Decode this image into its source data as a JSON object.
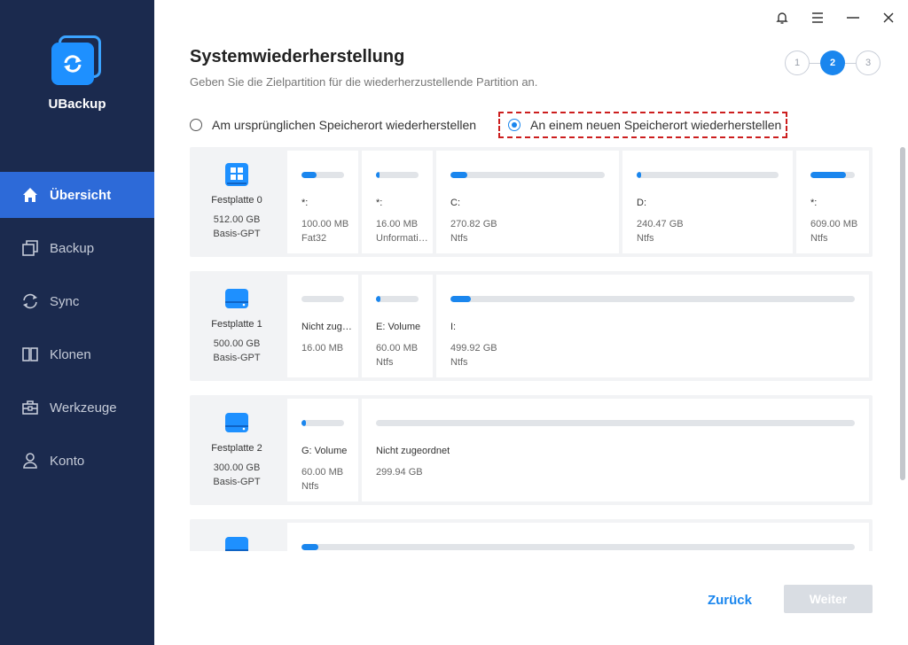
{
  "app": {
    "name": "UBackup"
  },
  "sidebar": {
    "items": [
      {
        "label": "Übersicht",
        "icon": "home-icon",
        "active": true
      },
      {
        "label": "Backup",
        "icon": "backup-icon"
      },
      {
        "label": "Sync",
        "icon": "sync-icon"
      },
      {
        "label": "Klonen",
        "icon": "clone-icon"
      },
      {
        "label": "Werkzeuge",
        "icon": "toolbox-icon"
      },
      {
        "label": "Konto",
        "icon": "user-icon"
      }
    ]
  },
  "header": {
    "title": "Systemwiederherstellung",
    "subtitle": "Geben Sie die Zielpartition für die wiederherzustellende Partition an."
  },
  "steps": [
    "1",
    "2",
    "3"
  ],
  "current_step": 2,
  "restore_options": {
    "original": "Am ursprünglichen Speicherort wiederherstellen",
    "new": "An einem neuen Speicherort wiederherstellen",
    "selected": "new"
  },
  "disks": [
    {
      "name": "Festplatte 0",
      "size": "512.00 GB",
      "type": "Basis-GPT",
      "partitions": [
        {
          "label": "*:",
          "size": "100.00 MB",
          "fs": "Fat32",
          "fill": 0.35
        },
        {
          "label": "*:",
          "size": "16.00 MB",
          "fs": "Unformatiert",
          "fill": 0.08
        },
        {
          "label": "C:",
          "size": "270.82 GB",
          "fs": "Ntfs",
          "fill": 0.11
        },
        {
          "label": "D:",
          "size": "240.47 GB",
          "fs": "Ntfs",
          "fill": 0.03
        },
        {
          "label": "*:",
          "size": "609.00 MB",
          "fs": "Ntfs",
          "fill": 0.8
        }
      ]
    },
    {
      "name": "Festplatte 1",
      "size": "500.00 GB",
      "type": "Basis-GPT",
      "partitions": [
        {
          "label": "Nicht zugeordnet",
          "size": "16.00 MB",
          "fs": "",
          "fill": 0
        },
        {
          "label": "E: Volume",
          "size": "60.00 MB",
          "fs": "Ntfs",
          "fill": 0.1
        },
        {
          "label": "I:",
          "size": "499.92 GB",
          "fs": "Ntfs",
          "fill": 0.05
        }
      ]
    },
    {
      "name": "Festplatte 2",
      "size": "300.00 GB",
      "type": "Basis-GPT",
      "partitions": [
        {
          "label": "G: Volume",
          "size": "60.00 MB",
          "fs": "Ntfs",
          "fill": 0.1
        },
        {
          "label": "Nicht zugeordnet",
          "size": "299.94 GB",
          "fs": "",
          "fill": 0
        }
      ]
    },
    {
      "name": "",
      "size": "",
      "type": "",
      "partitions": [
        {
          "label": "",
          "size": "",
          "fs": "",
          "fill": 0.005
        }
      ]
    }
  ],
  "buttons": {
    "back": "Zurück",
    "next": "Weiter"
  },
  "colors": {
    "sidebar": "#1b2a4e",
    "accent": "#1a86ee",
    "active_nav": "#2d6ad8",
    "highlight": "#cc1e1e"
  }
}
